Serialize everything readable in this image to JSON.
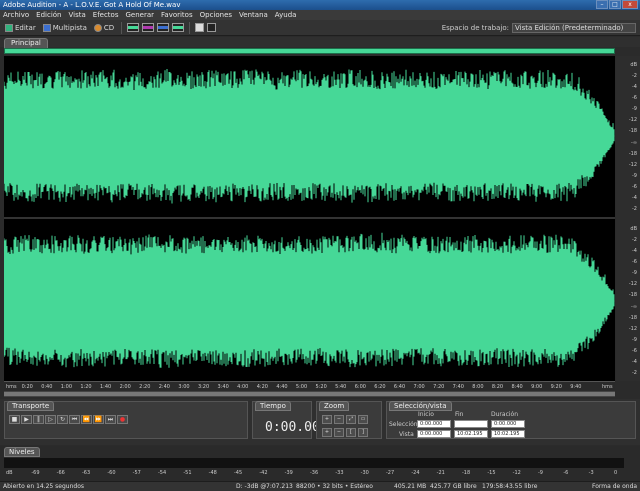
{
  "window": {
    "title": "Adobe Audition - A - L.O.V.E. Got A Hold Of Me.wav",
    "minimize": "–",
    "maximize": "□",
    "close": "x"
  },
  "menu": [
    "Archivo",
    "Edición",
    "Vista",
    "Efectos",
    "Generar",
    "Favoritos",
    "Opciones",
    "Ventana",
    "Ayuda"
  ],
  "toolbar": {
    "edit_label": "Editar",
    "multitrack_label": "Multipista",
    "cd_label": "CD",
    "workspace_label": "Espacio de trabajo:",
    "workspace_value": "Vista Edición (Predeterminado)"
  },
  "main_panel": {
    "tab": "Principal"
  },
  "ruler_right": {
    "unit": "dB",
    "top_channel": [
      "dB",
      "-2",
      "-4",
      "-6",
      "-9",
      "-12",
      "-18",
      "-∞",
      "-18",
      "-12",
      "-9",
      "-6",
      "-4",
      "-2"
    ],
    "bottom_channel": [
      "dB",
      "-2",
      "-4",
      "-6",
      "-9",
      "-12",
      "-18",
      "-∞",
      "-18",
      "-12",
      "-9",
      "-6",
      "-4",
      "-2"
    ]
  },
  "time_ruler": {
    "unit": "hms",
    "ticks": [
      "0:20",
      "0:40",
      "1:00",
      "1:20",
      "1:40",
      "2:00",
      "2:20",
      "2:40",
      "3:00",
      "3:20",
      "3:40",
      "4:00",
      "4:20",
      "4:40",
      "5:00",
      "5:20",
      "5:40",
      "6:00",
      "6:20",
      "6:40",
      "7:00",
      "7:20",
      "7:40",
      "8:00",
      "8:20",
      "8:40",
      "9:00",
      "9:20",
      "9:40"
    ],
    "end_unit": "hms"
  },
  "transport": {
    "tab": "Transporte"
  },
  "time_panel": {
    "tab": "Tiempo",
    "timecode": "0:00.000"
  },
  "zoom_panel": {
    "tab": "Zoom"
  },
  "selection_panel": {
    "tab": "Selección/vista",
    "col_start": "Inicio",
    "col_end": "Fin",
    "col_duration": "Duración",
    "row_selection": "Selección",
    "row_view": "Vista",
    "sel_start": "0:00.000",
    "sel_end": "",
    "sel_duration": "0:00.000",
    "view_start": "0:00.000",
    "view_end": "10:02.195",
    "view_duration": "10:02.195"
  },
  "levels": {
    "tab": "Niveles",
    "scale": [
      "dB",
      "-69",
      "-66",
      "-63",
      "-60",
      "-57",
      "-54",
      "-51",
      "-48",
      "-45",
      "-42",
      "-39",
      "-36",
      "-33",
      "-30",
      "-27",
      "-24",
      "-21",
      "-18",
      "-15",
      "-12",
      "-9",
      "-6",
      "-3",
      "0"
    ]
  },
  "status": {
    "opened": "Abierto en 14.25 segundos",
    "peak": "D: -3dB @",
    "peak_time": "7:07.213",
    "format": "88200 • 32 bits • Estéreo",
    "size": "405.21 MB",
    "free": "425.77 GB libre",
    "free_time": "179:58:43.55 libre",
    "view": "Forma de onda"
  },
  "colors": {
    "waveform": "#46d897",
    "background": "#000000"
  },
  "chart_data": {
    "type": "area",
    "channels": 2,
    "xlabel": "hms",
    "ylabel": "dB",
    "xlim": [
      "0:00",
      "10:02.195"
    ],
    "description_values": {
      "channel_top_envelope": [
        0.88,
        0.93,
        0.9,
        0.92,
        0.9,
        0.93,
        0.88,
        0.92,
        0.94,
        0.9,
        0.93,
        0.91,
        0.94,
        0.89,
        0.93,
        0.9,
        0.92,
        0.94,
        0.9,
        0.93,
        0.88,
        0.91,
        0.93,
        0.9,
        0.92,
        0.91,
        0.93,
        0.9,
        0.6,
        0.1
      ],
      "channel_bottom_envelope": [
        0.88,
        0.92,
        0.9,
        0.93,
        0.91,
        0.92,
        0.89,
        0.93,
        0.94,
        0.9,
        0.92,
        0.91,
        0.93,
        0.9,
        0.92,
        0.9,
        0.93,
        0.94,
        0.9,
        0.92,
        0.89,
        0.91,
        0.93,
        0.9,
        0.92,
        0.91,
        0.93,
        0.9,
        0.6,
        0.1
      ]
    }
  }
}
